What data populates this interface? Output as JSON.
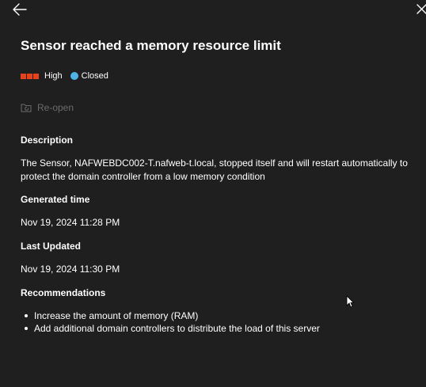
{
  "header": {
    "back_icon": "arrow-left-icon",
    "close_icon": "close-icon",
    "title": "Sensor reached a memory resource limit"
  },
  "status": {
    "severity_label": "High",
    "severity_color": "#e8421c",
    "state_label": "Closed",
    "state_color": "#4fb3e8"
  },
  "actions": {
    "reopen_label": "Re-open",
    "reopen_icon": "folder-refresh-icon"
  },
  "details": {
    "description_heading": "Description",
    "description_text": "The Sensor, NAFWEBDC002-T.nafweb-t.local, stopped itself and will restart automatically to protect the domain controller from a low memory condition",
    "generated_heading": "Generated time",
    "generated_value": "Nov 19, 2024 11:28 PM",
    "updated_heading": "Last Updated",
    "updated_value": "Nov 19, 2024 11:30 PM",
    "recommendations_heading": "Recommendations",
    "recommendations": [
      "Increase the amount of memory (RAM)",
      "Add additional domain controllers to distribute the load of this server"
    ]
  },
  "colors": {
    "background": "#1f1f1f",
    "text": "#ffffff",
    "disabled": "#6b6b6b"
  }
}
